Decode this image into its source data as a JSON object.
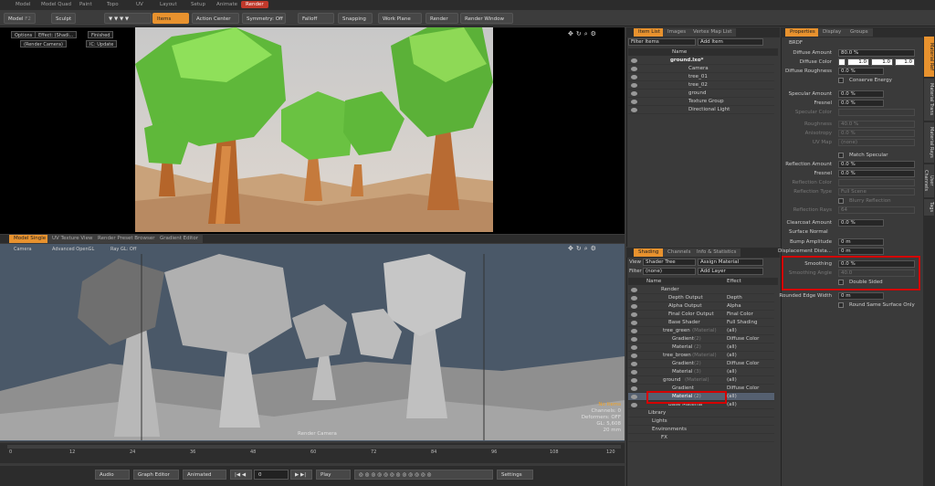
{
  "top_tabs": [
    "Model",
    "Model Quad",
    "Paint",
    "Topo",
    "UV",
    "Layout",
    "Setup",
    "Animate",
    "Render"
  ],
  "active_tab_index": 8,
  "toolbar": {
    "model": "Model",
    "f2": "F2",
    "sculpt": "Sculpt",
    "items": "Items",
    "action_center": "Action Center",
    "symmetry": "Symmetry: Off",
    "falloff": "Falloff",
    "snapping": "Snapping",
    "work_plane": "Work Plane",
    "render": "Render",
    "render_window": "Render Window"
  },
  "render_view": {
    "options": "Options",
    "effect": "Effect: (Shadi...",
    "finished": "Finished",
    "camera": "(Render Camera)",
    "ic_update": "IC: Update"
  },
  "viewport_tabs": [
    "Model Single",
    "UV Texture View",
    "Render Preset Browser",
    "Gradient Editor"
  ],
  "viewport": {
    "camera": "Camera",
    "opengl": "Advanced OpenGL",
    "ray_gl": "Ray GL: Off",
    "render_camera": "Render Camera",
    "info": [
      "No Items",
      "Channels: 0",
      "Deformers: OFF",
      "GL: 5,608",
      "20 mm"
    ]
  },
  "timeline": {
    "ticks": [
      "0",
      "12",
      "24",
      "36",
      "48",
      "60",
      "72",
      "84",
      "96",
      "108",
      "120"
    ]
  },
  "bottom_bar": {
    "audio": "Audio",
    "graph_editor": "Graph Editor",
    "animated": "Animated",
    "frame": "0",
    "play": "Play",
    "settings": "Settings"
  },
  "item_list": {
    "tabs": [
      "Item List",
      "Images",
      "Vertex Map List"
    ],
    "filter": "Filter Items",
    "add_item": "Add Item",
    "column": "Name",
    "rows": [
      "ground.lxo*",
      "Camera",
      "tree_01",
      "tree_02",
      "ground",
      "Texture Group",
      "Directional Light"
    ]
  },
  "shading": {
    "tabs": [
      "Shading",
      "Channels",
      "Info & Statistics"
    ],
    "view_label": "View",
    "view_value": "Shader Tree",
    "assign": "Assign Material",
    "filter_label": "Filter",
    "filter_value": "(none)",
    "add_layer": "Add Layer",
    "col_name": "Name",
    "col_effect": "Effect",
    "rows": [
      {
        "name": "Render",
        "tag": "",
        "effect": ""
      },
      {
        "name": "Depth Output",
        "tag": "",
        "effect": "Depth"
      },
      {
        "name": "Alpha Output",
        "tag": "",
        "effect": "Alpha"
      },
      {
        "name": "Final Color Output",
        "tag": "",
        "effect": "Final Color"
      },
      {
        "name": "Base Shader",
        "tag": "",
        "effect": "Full Shading"
      },
      {
        "name": "tree_green",
        "tag": "(Material)",
        "effect": "(all)"
      },
      {
        "name": "Gradient",
        "tag": "(2)",
        "effect": "Diffuse Color"
      },
      {
        "name": "Material",
        "tag": "(2)",
        "effect": "(all)"
      },
      {
        "name": "tree_brown",
        "tag": "(Material)",
        "effect": "(all)"
      },
      {
        "name": "Gradient",
        "tag": "(2)",
        "effect": "Diffuse Color"
      },
      {
        "name": "Material",
        "tag": "(3)",
        "effect": "(all)"
      },
      {
        "name": "ground",
        "tag": "(Material)",
        "effect": "(all)"
      },
      {
        "name": "Gradient",
        "tag": "",
        "effect": "Diffuse Color"
      },
      {
        "name": "Material",
        "tag": "(2)",
        "effect": "(all)"
      },
      {
        "name": "Base Material",
        "tag": "",
        "effect": "(all)"
      },
      {
        "name": "Library",
        "tag": "",
        "effect": ""
      },
      {
        "name": "Lights",
        "tag": "",
        "effect": ""
      },
      {
        "name": "Environments",
        "tag": "",
        "effect": ""
      },
      {
        "name": "FX",
        "tag": "",
        "effect": ""
      }
    ]
  },
  "properties": {
    "tabs": [
      "Properties",
      "Display",
      "Groups"
    ],
    "section": "BRDF",
    "diffuse_amount_label": "Diffuse Amount",
    "diffuse_amount": "80.0 %",
    "diffuse_color_label": "Diffuse Color",
    "diffuse_color": [
      "1.0",
      "1.0",
      "1.0"
    ],
    "diffuse_roughness_label": "Diffuse Roughness",
    "diffuse_roughness": "0.0 %",
    "conserve_energy": "Conserve Energy",
    "specular_amount_label": "Specular Amount",
    "specular_amount": "0.0 %",
    "fresnel_label": "Fresnel",
    "fresnel": "0.0 %",
    "specular_color_label": "Specular Color",
    "roughness_label": "Roughness",
    "roughness": "40.0 %",
    "anisotropy_label": "Anisotropy",
    "anisotropy": "0.0 %",
    "uv_map_label": "UV Map",
    "uv_map": "(none)",
    "match_specular": "Match Specular",
    "reflection_amount_label": "Reflection Amount",
    "reflection_amount": "0.0 %",
    "fresnel2_label": "Fresnel",
    "fresnel2": "0.0 %",
    "reflection_color_label": "Reflection Color",
    "reflection_type_label": "Reflection Type",
    "reflection_type": "Full Scene",
    "blurry_reflection": "Blurry Reflection",
    "reflection_rays_label": "Reflection Rays",
    "reflection_rays": "64",
    "clearcoat_label": "Clearcoat Amount",
    "clearcoat": "0.0 %",
    "surface_normal": "Surface Normal",
    "bump_label": "Bump Amplitude",
    "bump": "0 m",
    "displacement_label": "Displacement Dista...",
    "displacement": "0 m",
    "smoothing_label": "Smoothing",
    "smoothing": "0.0 %",
    "smoothing_angle_label": "Smoothing Angle",
    "smoothing_angle": "40.0",
    "double_sided": "Double Sided",
    "rounded_edge_label": "Rounded Edge Width",
    "rounded_edge": "0 m",
    "round_same_surface": "Round Same Surface Only",
    "side_tabs": [
      "Material Ref",
      "Material Trans",
      "Material Rays",
      "User Channels",
      "Tags"
    ]
  }
}
